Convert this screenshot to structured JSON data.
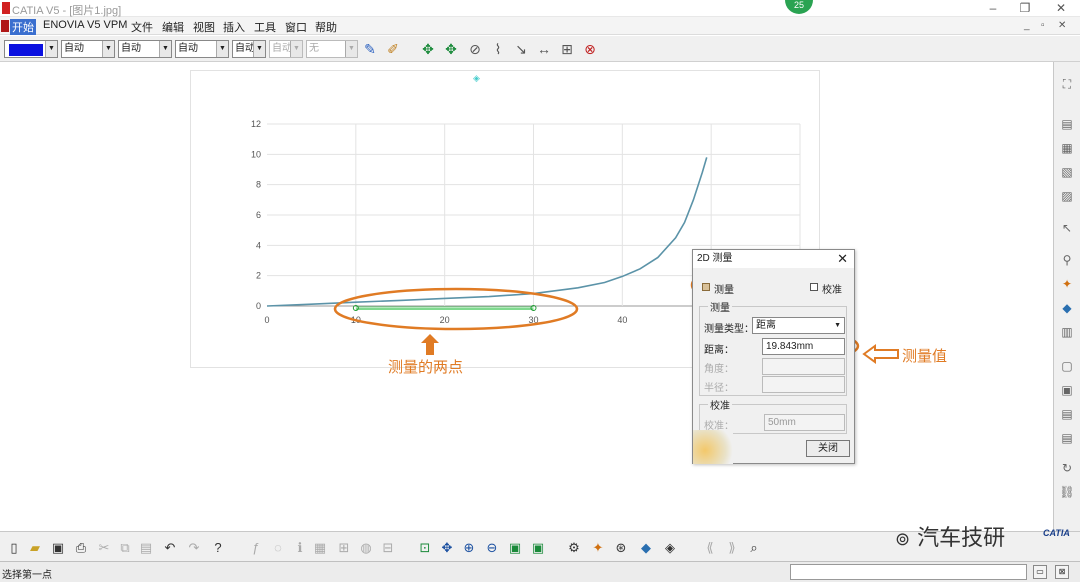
{
  "window": {
    "title": "CATIA V5 - [图片1.jpg]",
    "badge": "25"
  },
  "menu": [
    "开始",
    "ENOVIA V5 VPM",
    "文件",
    "编辑",
    "视图",
    "插入",
    "工具",
    "窗口",
    "帮助"
  ],
  "toolbar": {
    "color_value": "",
    "combos": [
      "自动",
      "自动",
      "自动",
      "自动",
      "自动",
      "自动",
      "无"
    ]
  },
  "chart_data": {
    "type": "line",
    "x_ticks": [
      "0",
      "10",
      "20",
      "30",
      "40"
    ],
    "y_ticks": [
      "0",
      "2",
      "4",
      "6",
      "8",
      "10",
      "12"
    ],
    "xlim": [
      0,
      60
    ],
    "ylim": [
      0,
      12
    ],
    "series": [
      {
        "x": [
          0,
          5,
          10,
          15,
          20,
          25,
          30,
          35,
          38,
          40,
          42,
          44,
          46,
          47,
          48,
          49,
          49.5
        ],
        "y": [
          0,
          0.12,
          0.25,
          0.37,
          0.5,
          0.62,
          0.82,
          1.2,
          1.55,
          1.95,
          2.45,
          3.2,
          4.5,
          5.5,
          7.0,
          8.8,
          9.8
        ]
      }
    ],
    "measure_segment": {
      "x": [
        10,
        30
      ],
      "y": [
        0,
        0
      ]
    },
    "grid": true
  },
  "dialog": {
    "title": "2D 测量",
    "measure_check_label": "测量",
    "calibrate_check_label": "校准",
    "measure_group_label": "测量",
    "measure_type_label": "测量类型：",
    "measure_type_value": "距离",
    "distance_label": "距离：",
    "distance_value": "19.843mm",
    "angle_label": "角度：",
    "radius_label": "半径：",
    "calib_group_label": "校准",
    "calib_label": "校准：",
    "calib_value": "50mm",
    "close_button": "关闭"
  },
  "annotations": {
    "points_note": "测量的两点",
    "value_note": "测量值",
    "highlight_color": "#e07b24"
  },
  "status": {
    "text": "选择第一点"
  },
  "watermark": {
    "text": "汽车技研",
    "logo_text": "CATIA"
  }
}
